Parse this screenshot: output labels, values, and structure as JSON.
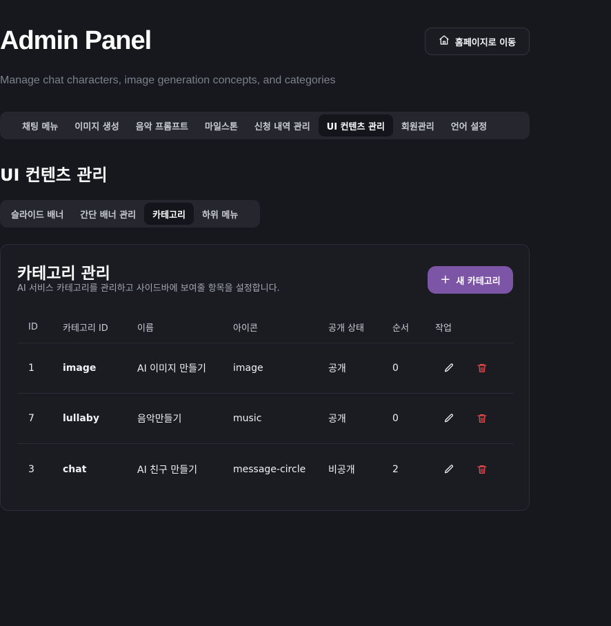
{
  "header": {
    "title": "Admin Panel",
    "subtitle": "Manage chat characters, image generation concepts, and categories",
    "home_button": "홈페이지로 이동"
  },
  "main_tabs": [
    {
      "label": "채팅 메뉴",
      "active": false
    },
    {
      "label": "이미지 생성",
      "active": false
    },
    {
      "label": "음악 프롬프트",
      "active": false
    },
    {
      "label": "마일스톤",
      "active": false
    },
    {
      "label": "신청 내역 관리",
      "active": false
    },
    {
      "label": "UI 컨텐츠 관리",
      "active": true
    },
    {
      "label": "회원관리",
      "active": false
    },
    {
      "label": "언어 설정",
      "active": false
    }
  ],
  "section_title": "UI 컨텐츠 관리",
  "sub_tabs": [
    {
      "label": "슬라이드 배너",
      "active": false
    },
    {
      "label": "간단 배너 관리",
      "active": false
    },
    {
      "label": "카테고리",
      "active": true
    },
    {
      "label": "하위 메뉴",
      "active": false
    }
  ],
  "card": {
    "title": "카테고리 관리",
    "description": "AI 서비스 카테고리를 관리하고 사이드바에 보여줄 항목을 설정합니다.",
    "new_button": "새 카테고리"
  },
  "table": {
    "columns": [
      "ID",
      "카테고리 ID",
      "이름",
      "아이콘",
      "공개 상태",
      "순서",
      "작업"
    ],
    "rows": [
      {
        "id": "1",
        "category_id": "image",
        "name": "AI 이미지 만들기",
        "icon": "image",
        "status": "공개",
        "order": "0"
      },
      {
        "id": "7",
        "category_id": "lullaby",
        "name": "음악만들기",
        "icon": "music",
        "status": "공개",
        "order": "0"
      },
      {
        "id": "3",
        "category_id": "chat",
        "name": "AI 친구 만들기",
        "icon": "message-circle",
        "status": "비공개",
        "order": "2"
      }
    ]
  },
  "colors": {
    "background": "#17181d",
    "accent": "#7d55a6",
    "delete": "#e5484d"
  }
}
